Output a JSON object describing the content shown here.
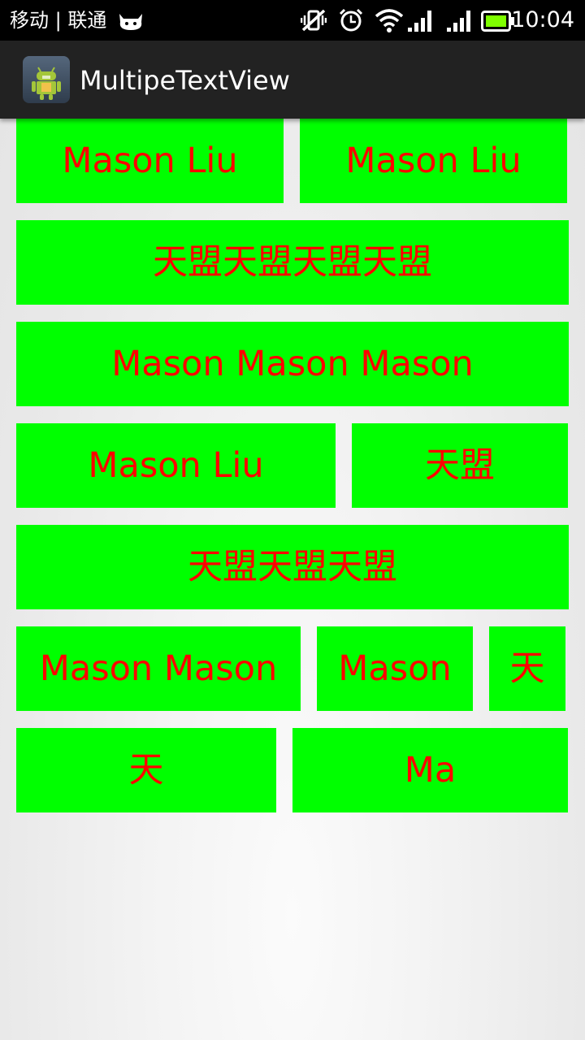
{
  "status_bar": {
    "carrier": "移动 | 联通",
    "time": "10:04",
    "icons": [
      "cat-notification-icon",
      "vibrate-off-icon",
      "alarm-icon",
      "wifi-icon",
      "signal-icon",
      "signal-icon",
      "battery-icon"
    ]
  },
  "action_bar": {
    "title": "MultipeTextView",
    "icon": "android-app-icon"
  },
  "colors": {
    "cell_background": "#00ff00",
    "cell_text": "#ff0000",
    "action_bar": "#222222",
    "status_bar": "#000000"
  },
  "rows": [
    [
      "Mason Liu",
      "Mason Liu"
    ],
    [
      "天盟天盟天盟天盟"
    ],
    [
      "Mason Mason Mason"
    ],
    [
      "Mason Liu",
      "天盟"
    ],
    [
      "天盟天盟天盟"
    ],
    [
      "Mason Mason",
      "Mason",
      "天"
    ],
    [
      "天",
      "Ma"
    ]
  ]
}
